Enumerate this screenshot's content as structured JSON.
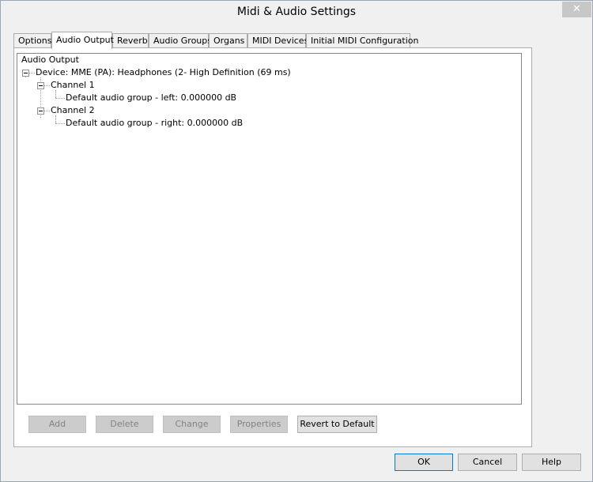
{
  "window": {
    "title": "Midi & Audio Settings",
    "close_glyph": "✕"
  },
  "tabs": [
    {
      "label": "Options"
    },
    {
      "label": "Audio Output"
    },
    {
      "label": "Reverb"
    },
    {
      "label": "Audio Groups"
    },
    {
      "label": "Organs"
    },
    {
      "label": "MIDI Devices"
    },
    {
      "label": "Initial MIDI Configuration"
    }
  ],
  "active_tab": "Audio Output",
  "tree": {
    "root": "Audio Output",
    "device": "Device: MME (PA): Headphones (2- High Definition  (69 ms)",
    "channel1": "Channel 1",
    "channel1_group": "Default audio group - left: 0.000000 dB",
    "channel2": "Channel 2",
    "channel2_group": "Default audio group - right: 0.000000 dB"
  },
  "panel_buttons": {
    "add": "Add",
    "delete": "Delete",
    "change": "Change",
    "properties": "Properties",
    "revert": "Revert to Default"
  },
  "dialog_buttons": {
    "ok": "OK",
    "cancel": "Cancel",
    "help": "Help"
  }
}
